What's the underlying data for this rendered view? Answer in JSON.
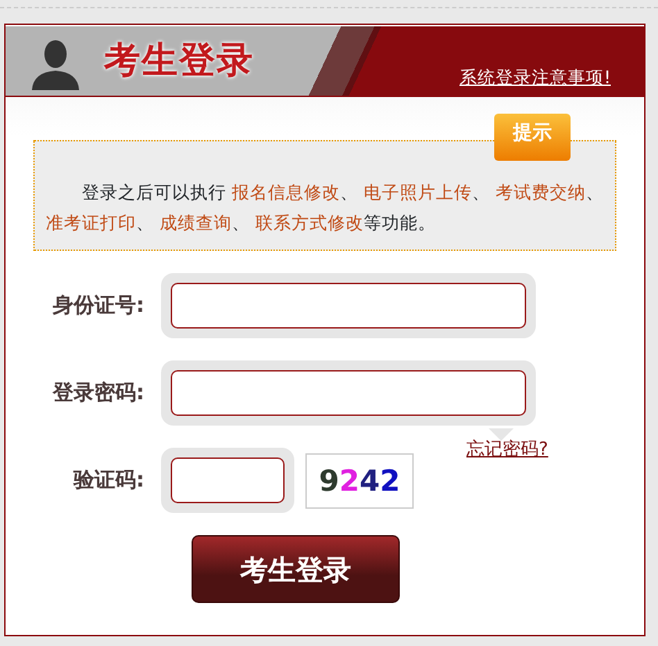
{
  "header": {
    "title": "考生登录",
    "notice_link": "系统登录注意事项!"
  },
  "tip": {
    "badge": "提示",
    "segments": [
      {
        "kind": "text",
        "text": "登录之后可以执行 "
      },
      {
        "kind": "link",
        "text": "报名信息修改"
      },
      {
        "kind": "text",
        "text": "、 "
      },
      {
        "kind": "link",
        "text": "电子照片上传"
      },
      {
        "kind": "text",
        "text": "、 "
      },
      {
        "kind": "link",
        "text": "考试费交纳"
      },
      {
        "kind": "text",
        "text": "、 "
      },
      {
        "kind": "link",
        "text": "准考证打印"
      },
      {
        "kind": "text",
        "text": "、 "
      },
      {
        "kind": "link",
        "text": "成绩查询"
      },
      {
        "kind": "text",
        "text": "、 "
      },
      {
        "kind": "link",
        "text": "联系方式修改"
      },
      {
        "kind": "text",
        "text": "等功能。"
      }
    ]
  },
  "fields": [
    {
      "label": "身份证号:"
    },
    {
      "label": "登录密码:"
    }
  ],
  "forgot_link": "忘记密码?",
  "captcha": {
    "label": "验证码:",
    "digits": [
      {
        "text": "9",
        "color": "#2e3b2e"
      },
      {
        "text": "2",
        "color": "#e020e0"
      },
      {
        "text": "4",
        "color": "#202080"
      },
      {
        "text": "2",
        "color": "#1010c0"
      }
    ]
  },
  "submit": "考生登录"
}
